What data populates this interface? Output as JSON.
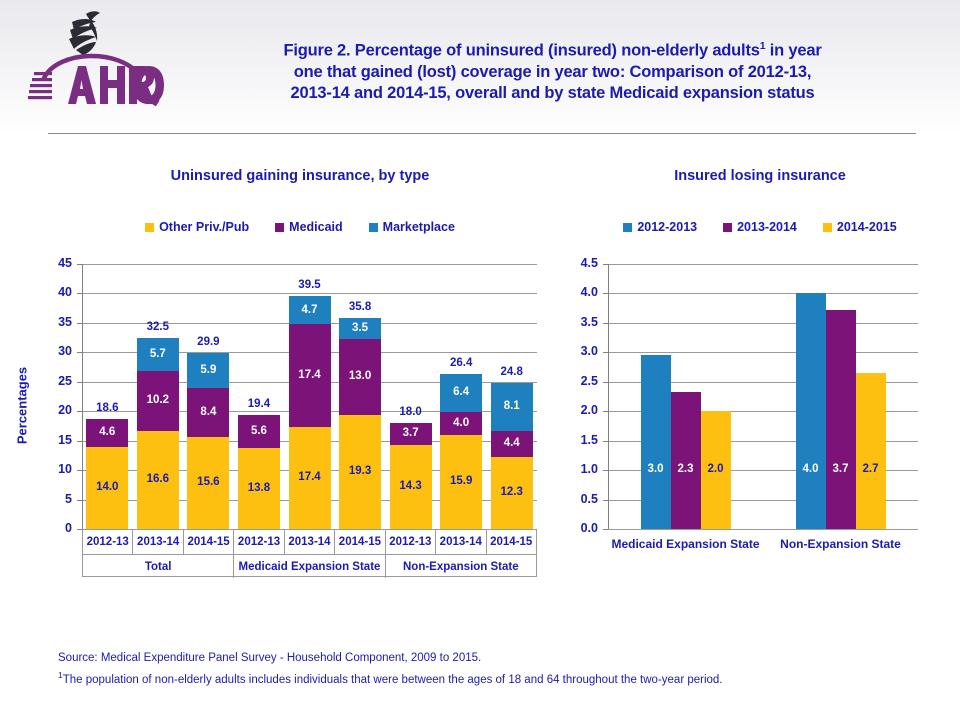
{
  "header": {
    "logo_alt": "AHRQ Agency for Healthcare Research and Quality",
    "logo_text": "AHRQ",
    "title_line1": "Figure 2. Percentage of uninsured (insured) non-elderly adults",
    "title_sup": "1",
    "title_line1b": " in year",
    "title_line2": "one that gained (lost) coverage in year two: Comparison of 2012-13,",
    "title_line3": "2013-14 and 2014-15, overall and by state Medicaid expansion status"
  },
  "colors": {
    "gold": "#FDC010",
    "purple": "#7C1378",
    "blue": "#1F80C0",
    "text_blue": "#1b1bae",
    "gridline": "#9a9a9a"
  },
  "left_panel": {
    "title": "Uninsured gaining insurance, by type",
    "ylabel": "Percentages",
    "legend": [
      {
        "label": "Other Priv./Pub",
        "color": "#FDC010"
      },
      {
        "label": "Medicaid",
        "color": "#7C1378"
      },
      {
        "label": "Marketplace",
        "color": "#1F80C0"
      }
    ]
  },
  "right_panel": {
    "title": "Insured losing insurance",
    "legend": [
      {
        "label": "2012-2013",
        "color": "#1F80C0"
      },
      {
        "label": "2013-2014",
        "color": "#7C1378"
      },
      {
        "label": "2014-2015",
        "color": "#FDC010"
      }
    ]
  },
  "footnotes": {
    "source": "Source:  Medical Expenditure Panel Survey  - Household Component, 2009 to 2015.",
    "note_sup": "1",
    "note": "The population of non-elderly adults includes individuals that were between the ages of 18 and 64 throughout the two-year period."
  },
  "chart_data": [
    {
      "type": "bar",
      "subtype": "stacked",
      "title": "Uninsured gaining insurance, by type",
      "xlabel": "",
      "ylabel": "Percentages",
      "ylim": [
        0,
        45
      ],
      "yticks": [
        0,
        5,
        10,
        15,
        20,
        25,
        30,
        35,
        40,
        45
      ],
      "grid": true,
      "legend_position": "top",
      "categories": [
        "2012-13",
        "2013-14",
        "2014-15",
        "2012-13",
        "2013-14",
        "2014-15",
        "2012-13",
        "2013-14",
        "2014-15"
      ],
      "groups": [
        {
          "name": "Total",
          "categories": [
            "2012-13",
            "2013-14",
            "2014-15"
          ]
        },
        {
          "name": "Medicaid Expansion State",
          "categories": [
            "2012-13",
            "2013-14",
            "2014-15"
          ]
        },
        {
          "name": "Non-Expansion State",
          "categories": [
            "2012-13",
            "2013-14",
            "2014-15"
          ]
        }
      ],
      "series": [
        {
          "name": "Other Priv./Pub",
          "color": "#FDC010",
          "values": [
            14.0,
            16.6,
            15.6,
            13.8,
            17.4,
            19.3,
            14.3,
            15.9,
            12.3
          ]
        },
        {
          "name": "Medicaid",
          "color": "#7C1378",
          "values": [
            4.6,
            10.2,
            8.4,
            5.6,
            17.4,
            13.0,
            3.7,
            4.0,
            4.4
          ]
        },
        {
          "name": "Marketplace",
          "color": "#1F80C0",
          "values": [
            null,
            5.7,
            5.9,
            null,
            4.7,
            3.5,
            null,
            6.4,
            8.1
          ]
        }
      ],
      "totals": [
        18.6,
        32.5,
        29.9,
        19.4,
        39.5,
        35.8,
        18.0,
        26.4,
        24.8
      ]
    },
    {
      "type": "bar",
      "subtype": "grouped",
      "title": "Insured losing insurance",
      "xlabel": "",
      "ylabel": "",
      "ylim": [
        0,
        4.5
      ],
      "yticks": [
        0.0,
        0.5,
        1.0,
        1.5,
        2.0,
        2.5,
        3.0,
        3.5,
        4.0,
        4.5
      ],
      "grid": true,
      "legend_position": "top",
      "categories": [
        "Medicaid Expansion State",
        "Non-Expansion State"
      ],
      "series": [
        {
          "name": "2012-2013",
          "color": "#1F80C0",
          "values": [
            3.0,
            4.0
          ],
          "plotted": [
            2.96,
            4.0
          ]
        },
        {
          "name": "2013-2014",
          "color": "#7C1378",
          "values": [
            2.3,
            3.7
          ],
          "plotted": [
            2.33,
            3.72
          ]
        },
        {
          "name": "2014-2015",
          "color": "#FDC010",
          "values": [
            2.0,
            2.7
          ],
          "plotted": [
            2.01,
            2.65
          ]
        }
      ]
    }
  ]
}
